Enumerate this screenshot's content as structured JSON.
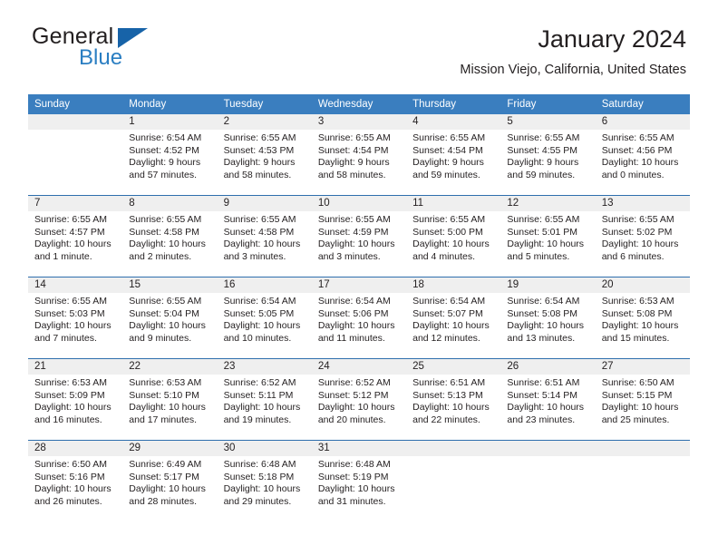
{
  "brand": {
    "name_part1": "General",
    "name_part2": "Blue",
    "flag_icon": "triangle-flag-icon",
    "accent_color": "#1763a8",
    "blue_text_color": "#2a7ec2"
  },
  "header": {
    "title": "January 2024",
    "subtitle": "Mission Viejo, California, United States"
  },
  "calendar": {
    "header_bg_color": "#3a7ebf",
    "daynum_bg_color": "#efefef",
    "week_divider_color": "#2f6fad",
    "weekdays": [
      "Sunday",
      "Monday",
      "Tuesday",
      "Wednesday",
      "Thursday",
      "Friday",
      "Saturday"
    ],
    "weeks": [
      [
        {
          "day": "",
          "sunrise": "",
          "sunset": "",
          "daylight": ""
        },
        {
          "day": "1",
          "sunrise": "Sunrise: 6:54 AM",
          "sunset": "Sunset: 4:52 PM",
          "daylight": "Daylight: 9 hours and 57 minutes."
        },
        {
          "day": "2",
          "sunrise": "Sunrise: 6:55 AM",
          "sunset": "Sunset: 4:53 PM",
          "daylight": "Daylight: 9 hours and 58 minutes."
        },
        {
          "day": "3",
          "sunrise": "Sunrise: 6:55 AM",
          "sunset": "Sunset: 4:54 PM",
          "daylight": "Daylight: 9 hours and 58 minutes."
        },
        {
          "day": "4",
          "sunrise": "Sunrise: 6:55 AM",
          "sunset": "Sunset: 4:54 PM",
          "daylight": "Daylight: 9 hours and 59 minutes."
        },
        {
          "day": "5",
          "sunrise": "Sunrise: 6:55 AM",
          "sunset": "Sunset: 4:55 PM",
          "daylight": "Daylight: 9 hours and 59 minutes."
        },
        {
          "day": "6",
          "sunrise": "Sunrise: 6:55 AM",
          "sunset": "Sunset: 4:56 PM",
          "daylight": "Daylight: 10 hours and 0 minutes."
        }
      ],
      [
        {
          "day": "7",
          "sunrise": "Sunrise: 6:55 AM",
          "sunset": "Sunset: 4:57 PM",
          "daylight": "Daylight: 10 hours and 1 minute."
        },
        {
          "day": "8",
          "sunrise": "Sunrise: 6:55 AM",
          "sunset": "Sunset: 4:58 PM",
          "daylight": "Daylight: 10 hours and 2 minutes."
        },
        {
          "day": "9",
          "sunrise": "Sunrise: 6:55 AM",
          "sunset": "Sunset: 4:58 PM",
          "daylight": "Daylight: 10 hours and 3 minutes."
        },
        {
          "day": "10",
          "sunrise": "Sunrise: 6:55 AM",
          "sunset": "Sunset: 4:59 PM",
          "daylight": "Daylight: 10 hours and 3 minutes."
        },
        {
          "day": "11",
          "sunrise": "Sunrise: 6:55 AM",
          "sunset": "Sunset: 5:00 PM",
          "daylight": "Daylight: 10 hours and 4 minutes."
        },
        {
          "day": "12",
          "sunrise": "Sunrise: 6:55 AM",
          "sunset": "Sunset: 5:01 PM",
          "daylight": "Daylight: 10 hours and 5 minutes."
        },
        {
          "day": "13",
          "sunrise": "Sunrise: 6:55 AM",
          "sunset": "Sunset: 5:02 PM",
          "daylight": "Daylight: 10 hours and 6 minutes."
        }
      ],
      [
        {
          "day": "14",
          "sunrise": "Sunrise: 6:55 AM",
          "sunset": "Sunset: 5:03 PM",
          "daylight": "Daylight: 10 hours and 7 minutes."
        },
        {
          "day": "15",
          "sunrise": "Sunrise: 6:55 AM",
          "sunset": "Sunset: 5:04 PM",
          "daylight": "Daylight: 10 hours and 9 minutes."
        },
        {
          "day": "16",
          "sunrise": "Sunrise: 6:54 AM",
          "sunset": "Sunset: 5:05 PM",
          "daylight": "Daylight: 10 hours and 10 minutes."
        },
        {
          "day": "17",
          "sunrise": "Sunrise: 6:54 AM",
          "sunset": "Sunset: 5:06 PM",
          "daylight": "Daylight: 10 hours and 11 minutes."
        },
        {
          "day": "18",
          "sunrise": "Sunrise: 6:54 AM",
          "sunset": "Sunset: 5:07 PM",
          "daylight": "Daylight: 10 hours and 12 minutes."
        },
        {
          "day": "19",
          "sunrise": "Sunrise: 6:54 AM",
          "sunset": "Sunset: 5:08 PM",
          "daylight": "Daylight: 10 hours and 13 minutes."
        },
        {
          "day": "20",
          "sunrise": "Sunrise: 6:53 AM",
          "sunset": "Sunset: 5:08 PM",
          "daylight": "Daylight: 10 hours and 15 minutes."
        }
      ],
      [
        {
          "day": "21",
          "sunrise": "Sunrise: 6:53 AM",
          "sunset": "Sunset: 5:09 PM",
          "daylight": "Daylight: 10 hours and 16 minutes."
        },
        {
          "day": "22",
          "sunrise": "Sunrise: 6:53 AM",
          "sunset": "Sunset: 5:10 PM",
          "daylight": "Daylight: 10 hours and 17 minutes."
        },
        {
          "day": "23",
          "sunrise": "Sunrise: 6:52 AM",
          "sunset": "Sunset: 5:11 PM",
          "daylight": "Daylight: 10 hours and 19 minutes."
        },
        {
          "day": "24",
          "sunrise": "Sunrise: 6:52 AM",
          "sunset": "Sunset: 5:12 PM",
          "daylight": "Daylight: 10 hours and 20 minutes."
        },
        {
          "day": "25",
          "sunrise": "Sunrise: 6:51 AM",
          "sunset": "Sunset: 5:13 PM",
          "daylight": "Daylight: 10 hours and 22 minutes."
        },
        {
          "day": "26",
          "sunrise": "Sunrise: 6:51 AM",
          "sunset": "Sunset: 5:14 PM",
          "daylight": "Daylight: 10 hours and 23 minutes."
        },
        {
          "day": "27",
          "sunrise": "Sunrise: 6:50 AM",
          "sunset": "Sunset: 5:15 PM",
          "daylight": "Daylight: 10 hours and 25 minutes."
        }
      ],
      [
        {
          "day": "28",
          "sunrise": "Sunrise: 6:50 AM",
          "sunset": "Sunset: 5:16 PM",
          "daylight": "Daylight: 10 hours and 26 minutes."
        },
        {
          "day": "29",
          "sunrise": "Sunrise: 6:49 AM",
          "sunset": "Sunset: 5:17 PM",
          "daylight": "Daylight: 10 hours and 28 minutes."
        },
        {
          "day": "30",
          "sunrise": "Sunrise: 6:48 AM",
          "sunset": "Sunset: 5:18 PM",
          "daylight": "Daylight: 10 hours and 29 minutes."
        },
        {
          "day": "31",
          "sunrise": "Sunrise: 6:48 AM",
          "sunset": "Sunset: 5:19 PM",
          "daylight": "Daylight: 10 hours and 31 minutes."
        },
        {
          "day": "",
          "sunrise": "",
          "sunset": "",
          "daylight": ""
        },
        {
          "day": "",
          "sunrise": "",
          "sunset": "",
          "daylight": ""
        },
        {
          "day": "",
          "sunrise": "",
          "sunset": "",
          "daylight": ""
        }
      ]
    ]
  }
}
